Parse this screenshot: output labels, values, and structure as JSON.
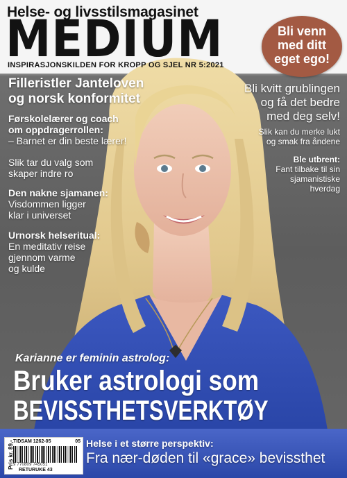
{
  "masthead": {
    "kicker": "Helse- og livsstilsmagasinet",
    "title": "MEDIUM",
    "subline": "INSPIRASJONSKILDEN FOR KROPP OG SJEL NR 5:2021"
  },
  "badge": {
    "lines": [
      "Bli venn",
      "med ditt",
      "eget ego!"
    ]
  },
  "left_column": {
    "headline": [
      "Filleristler Janteloven",
      "og norsk konformitet"
    ],
    "story1": {
      "title": [
        "Førskolelærer og coach",
        "om oppdragerrollen:"
      ],
      "body": "– Barnet er din beste lærer!"
    },
    "story2": {
      "body": [
        "Slik tar du valg som",
        "skaper indre ro"
      ]
    },
    "story3": {
      "title": "Den nakne sjamanen:",
      "body": [
        "Visdommen ligger",
        "klar i universet"
      ]
    },
    "story4": {
      "title": "Urnorsk helseritual:",
      "body": [
        "En meditativ reise",
        "gjennom varme",
        "og kulde"
      ]
    }
  },
  "right_column": {
    "headline": [
      "Bli kvitt grublingen",
      "og få det bedre",
      "med deg selv!"
    ],
    "story1": [
      "Slik kan du merke lukt",
      "og smak fra åndene"
    ],
    "story2": {
      "title": "Ble utbrent:",
      "body": [
        "Fant tilbake til sin",
        "sjamanistiske",
        "hverdag"
      ]
    }
  },
  "cover_story": {
    "kicker": "Karianne er feminin astrolog:",
    "line1": "Bruker astrologi som",
    "line2": "BEVISSTHETSVERKTØY"
  },
  "bottom": {
    "kicker": "Helse i et større perspektiv:",
    "headline": "Fra nær-døden til «grace» bevissthet"
  },
  "barcode_box": {
    "price": "Pris kr. 89,-",
    "code": "TIDSAM 1262-05",
    "issue": "05",
    "digits": "9 770809 745051",
    "return": "RETURUKE 43"
  },
  "colors": {
    "badge": "#a35a43",
    "shirt": "#2b47a8",
    "background": "#666666",
    "hair": "#e7d29a"
  }
}
